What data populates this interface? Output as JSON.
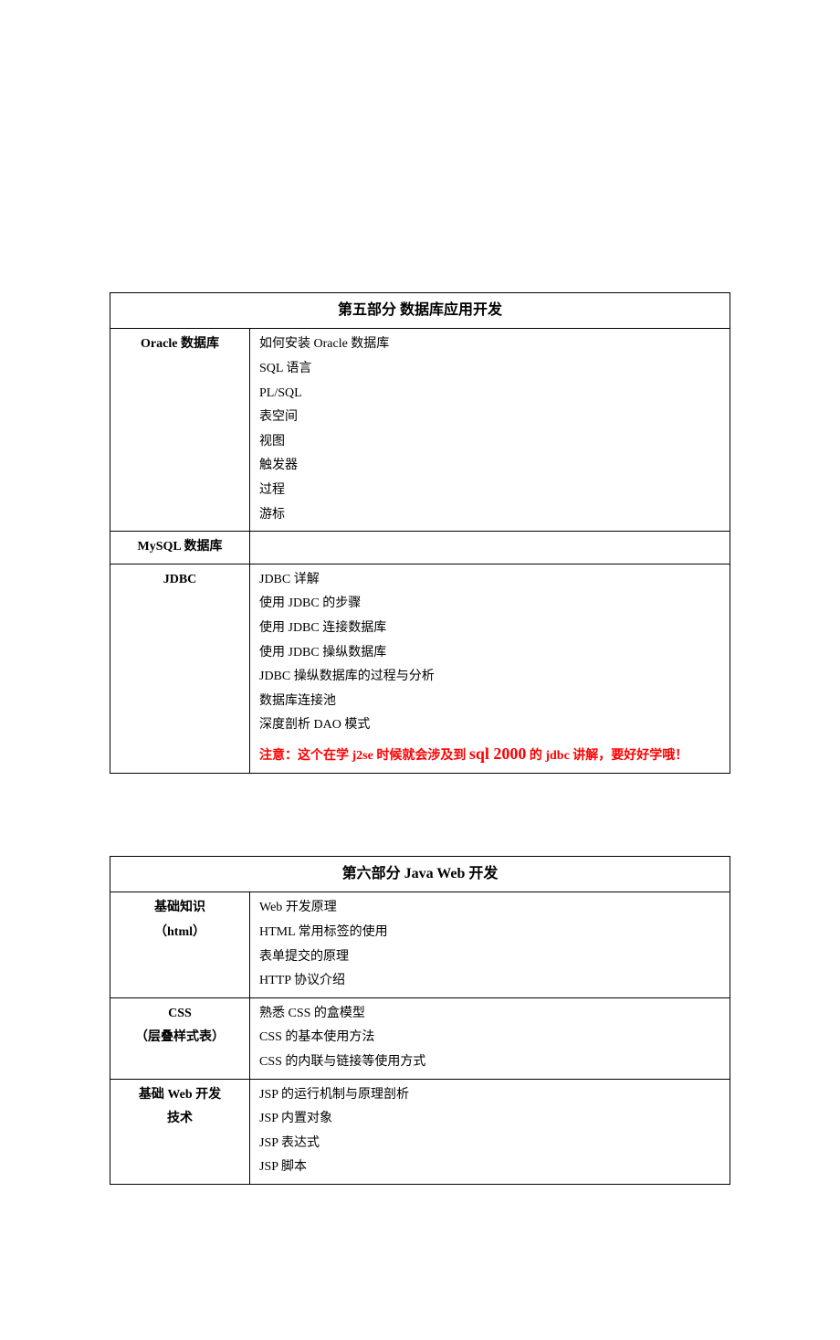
{
  "section5": {
    "title": "第五部分  数据库应用开发",
    "rows": [
      {
        "left": "Oracle 数据库",
        "items": [
          "如何安装 Oracle 数据库",
          "SQL 语言",
          "PL/SQL",
          "表空间",
          "视图",
          "触发器",
          "过程",
          "游标"
        ]
      },
      {
        "left": "MySQL 数据库",
        "items": []
      },
      {
        "left": "JDBC",
        "items": [
          "JDBC 详解",
          "使用 JDBC 的步骤",
          "使用 JDBC 连接数据库",
          "使用 JDBC 操纵数据库",
          "JDBC 操纵数据库的过程与分析",
          "数据库连接池",
          "深度剖析 DAO 模式"
        ],
        "note_pre": "注意：这个在学 j2se 时候就会涉及到  ",
        "note_big": "sql 2000",
        "note_post": "  的 jdbc 讲解，要好好学哦！"
      }
    ]
  },
  "section6": {
    "title": "第六部分  Java Web 开发",
    "rows": [
      {
        "left_line1": "基础知识",
        "left_line2": "（html）",
        "items": [
          "Web 开发原理",
          "HTML 常用标签的使用",
          "表单提交的原理",
          "HTTP 协议介绍"
        ]
      },
      {
        "left_line1": "CSS",
        "left_line2": "（层叠样式表）",
        "items": [
          "熟悉 CSS 的盒模型",
          "CSS 的基本使用方法",
          "CSS 的内联与链接等使用方式"
        ]
      },
      {
        "left_line1": "基础 Web 开发",
        "left_line2": "技术",
        "items": [
          "JSP 的运行机制与原理剖析",
          "JSP 内置对象",
          "JSP 表达式",
          "JSP 脚本"
        ]
      }
    ]
  }
}
